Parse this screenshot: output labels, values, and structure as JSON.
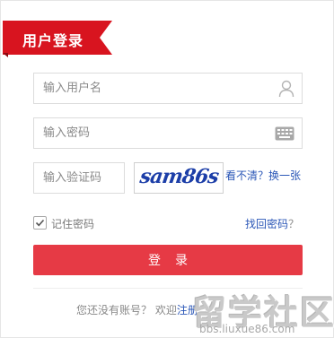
{
  "header": {
    "title": "用户登录"
  },
  "form": {
    "username_placeholder": "输入用户名",
    "password_placeholder": "输入密码",
    "captcha_placeholder": "输入验证码",
    "captcha_image_text": "sam86s",
    "captcha_refresh": "看不清？换一张",
    "remember_label": "记住密码",
    "remember_checked": true,
    "forgot_label": "找回密码",
    "forgot_suffix": "？",
    "login_button": "登录"
  },
  "footer": {
    "register_prompt": "您还没有账号？ 欢迎",
    "register_link": "注册"
  },
  "watermark": {
    "main": "留学社区",
    "sub": "bbs.liuxue86.com"
  },
  "colors": {
    "ribbon": "#d8141f",
    "button": "#e63a45",
    "link": "#2b57b7"
  }
}
